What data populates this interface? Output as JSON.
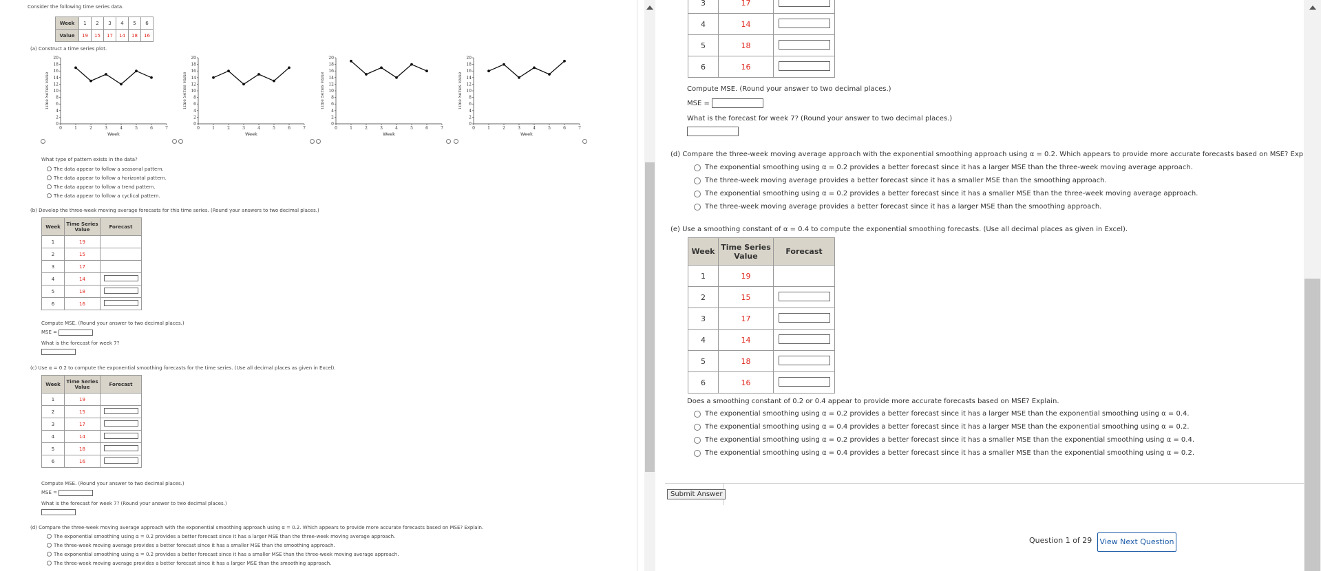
{
  "colors": {
    "accent": "#e0281f",
    "header_bg": "#d9d4c9",
    "link_blue": "#1a5aa6"
  },
  "intro": "Consider the following time series data.",
  "data_table": {
    "week_label": "Week",
    "value_label": "Value",
    "weeks": [
      "1",
      "2",
      "3",
      "4",
      "5",
      "6"
    ],
    "values": [
      "19",
      "15",
      "17",
      "14",
      "18",
      "16"
    ]
  },
  "part_a": {
    "prompt": "(a)  Construct a time series plot.",
    "ylabel": "Time Series Value",
    "xlabel": "Week",
    "yticks": [
      "20",
      "18",
      "16",
      "14",
      "12",
      "10",
      "8",
      "6",
      "4",
      "2",
      "0"
    ],
    "xticks": [
      "0",
      "1",
      "2",
      "3",
      "4",
      "5",
      "6",
      "7"
    ],
    "info_icon": "info-icon",
    "chart_data": [
      {
        "type": "line",
        "x": [
          1,
          2,
          3,
          4,
          5,
          6
        ],
        "y": [
          17,
          13,
          15,
          12,
          16,
          14
        ],
        "xlim": [
          0,
          7
        ],
        "ylim": [
          0,
          20
        ],
        "xlabel": "Week",
        "ylabel": "Time Series Value"
      },
      {
        "type": "line",
        "x": [
          1,
          2,
          3,
          4,
          5,
          6
        ],
        "y": [
          14,
          16,
          12,
          15,
          13,
          17
        ],
        "xlim": [
          0,
          7
        ],
        "ylim": [
          0,
          20
        ],
        "xlabel": "Week",
        "ylabel": "Time Series Value"
      },
      {
        "type": "line",
        "x": [
          1,
          2,
          3,
          4,
          5,
          6
        ],
        "y": [
          19,
          15,
          17,
          14,
          18,
          16
        ],
        "xlim": [
          0,
          7
        ],
        "ylim": [
          0,
          20
        ],
        "xlabel": "Week",
        "ylabel": "Time Series Value"
      },
      {
        "type": "line",
        "x": [
          1,
          2,
          3,
          4,
          5,
          6
        ],
        "y": [
          16,
          18,
          14,
          17,
          15,
          19
        ],
        "xlim": [
          0,
          7
        ],
        "ylim": [
          0,
          20
        ],
        "xlabel": "Week",
        "ylabel": "Time Series Value"
      }
    ],
    "pattern_q": "What type of pattern exists in the data?",
    "pattern_opts": [
      "The data appear to follow a seasonal pattern.",
      "The data appear to follow a horizontal pattern.",
      "The data appear to follow a trend pattern.",
      "The data appear to follow a cyclical pattern."
    ]
  },
  "part_b": {
    "prompt": "(b)  Develop the three-week moving average forecasts for this time series. (Round your answers to two decimal places.)",
    "mse_prompt": "Compute MSE. (Round your answer to two decimal places.)",
    "mse_label": "MSE =",
    "forecast_q": "What is the forecast for week 7?"
  },
  "tbl_head": {
    "week": "Week",
    "value": "Time Series Value",
    "forecast": "Forecast"
  },
  "rows": [
    {
      "week": "1",
      "value": "19"
    },
    {
      "week": "2",
      "value": "15"
    },
    {
      "week": "3",
      "value": "17"
    },
    {
      "week": "4",
      "value": "14"
    },
    {
      "week": "5",
      "value": "18"
    },
    {
      "week": "6",
      "value": "16"
    }
  ],
  "part_c": {
    "prompt": "(c)  Use α = 0.2 to compute the exponential smoothing forecasts for the time series. (Use all decimal places as given in Excel).",
    "mse_prompt": "Compute MSE. (Round your answer to two decimal places.)",
    "mse_label": "MSE =",
    "forecast_q": "What is the forecast for week 7? (Round your answer to two decimal places.)"
  },
  "part_d": {
    "prompt": "(d)  Compare the three-week moving average approach with the exponential smoothing approach using α = 0.2. Which appears to provide more accurate forecasts based on MSE? Explain.",
    "opts": [
      "The exponential smoothing using α = 0.2 provides a better forecast since it has a larger MSE than the three-week moving average approach.",
      "The three-week moving average provides a better forecast since it has a smaller MSE than the smoothing approach.",
      "The exponential smoothing using α = 0.2 provides a better forecast since it has a smaller MSE than the three-week moving average approach.",
      "The three-week moving average provides a better forecast since it has a larger MSE than the smoothing approach."
    ]
  },
  "part_e": {
    "prompt": "(e)  Use a smoothing constant of α = 0.4 to compute the exponential smoothing forecasts. (Use all decimal places as given in Excel).",
    "q": "Does a smoothing constant of 0.2 or 0.4 appear to provide more accurate forecasts based on MSE? Explain.",
    "opts": [
      "The exponential smoothing using α = 0.2 provides a better forecast since it has a larger MSE than the exponential smoothing using α = 0.4.",
      "The exponential smoothing using α = 0.4 provides a better forecast since it has a larger MSE than the exponential smoothing using α = 0.2.",
      "The exponential smoothing using α = 0.2 provides a better forecast since it has a smaller MSE than the exponential smoothing using α = 0.4.",
      "The exponential smoothing using α = 0.4 provides a better forecast since it has a smaller MSE than the exponential smoothing using α = 0.2."
    ]
  },
  "submit_label": "Submit Answer",
  "question_counter": "Question 1 of 29",
  "next_label": "View Next Question"
}
